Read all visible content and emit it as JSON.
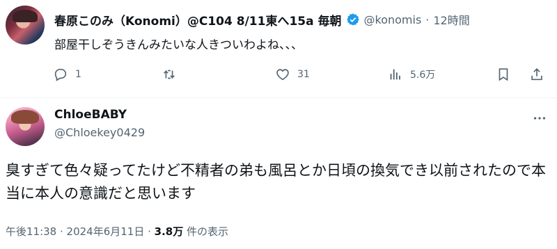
{
  "top_tweet": {
    "display_name": "春原このみ（Konomi）@C104 8/11東へ15a 毎朝",
    "handle": "@konomis",
    "time": "12時間",
    "text": "部屋干しぞうきんみたいな人きついわよね、、、",
    "actions": {
      "reply_count": "1",
      "retweet_count": "",
      "like_count": "31",
      "view_count": "5.6万"
    }
  },
  "reply_tweet": {
    "display_name": "ChloeBABY",
    "handle": "@Chloekey0429",
    "text": "臭すぎて色々疑ってたけど不精者の弟も風呂とか日頃の換気でき以前されたので本当に本人の意識だと思います",
    "timestamp": "午後11:38 · 2024年6月11日 · ",
    "views": "3.8万",
    "views_suffix": " 件の表示"
  },
  "colors": {
    "text": "#0f1419",
    "secondary": "#536471",
    "verified": "#1d9bf0"
  }
}
